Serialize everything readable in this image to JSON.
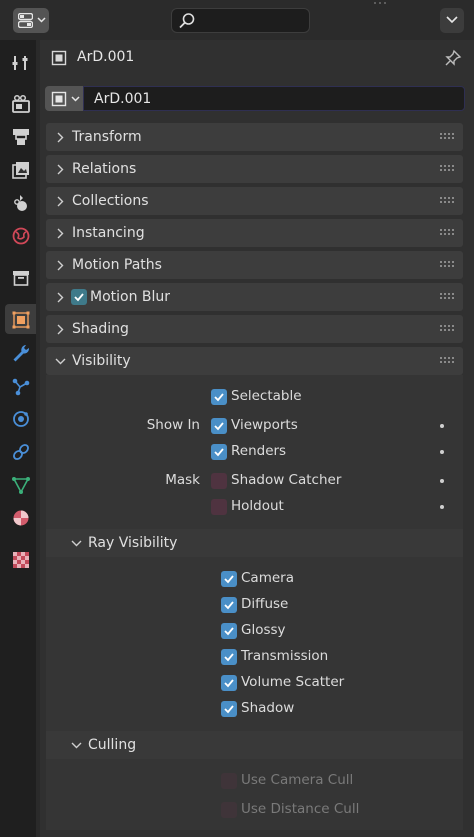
{
  "header": {
    "editor_icon": "properties-editor-icon",
    "search_icon": "search-icon",
    "menu_icon": "chevron-down-icon"
  },
  "tabs": [
    {
      "name": "tool",
      "icon": "tool-icon"
    },
    {
      "name": "render",
      "icon": "render-icon"
    },
    {
      "name": "output",
      "icon": "output-icon"
    },
    {
      "name": "view-layer",
      "icon": "view-layer-icon"
    },
    {
      "name": "scene",
      "icon": "scene-icon"
    },
    {
      "name": "world",
      "icon": "world-icon"
    },
    {
      "name": "collection",
      "icon": "collection-icon"
    },
    {
      "name": "object",
      "icon": "object-icon",
      "active": true
    },
    {
      "name": "modifiers",
      "icon": "wrench-icon"
    },
    {
      "name": "particles",
      "icon": "particles-icon"
    },
    {
      "name": "physics",
      "icon": "physics-icon"
    },
    {
      "name": "constraints",
      "icon": "constraints-icon"
    },
    {
      "name": "data",
      "icon": "mesh-data-icon"
    },
    {
      "name": "material",
      "icon": "material-icon"
    },
    {
      "name": "texture",
      "icon": "texture-icon"
    }
  ],
  "context": {
    "object_name": "ArD.001",
    "name_field_value": "ArD.001"
  },
  "panels": {
    "transform": "Transform",
    "relations": "Relations",
    "collections": "Collections",
    "instancing": "Instancing",
    "motion_paths": "Motion Paths",
    "motion_blur": "Motion Blur",
    "shading": "Shading",
    "visibility": "Visibility"
  },
  "motion_blur_enabled": true,
  "visibility": {
    "selectable": {
      "label": "Selectable",
      "checked": true
    },
    "show_in_label": "Show In",
    "viewports": {
      "label": "Viewports",
      "checked": true
    },
    "renders": {
      "label": "Renders",
      "checked": true
    },
    "mask_label": "Mask",
    "shadow_catcher": {
      "label": "Shadow Catcher",
      "checked": false
    },
    "holdout": {
      "label": "Holdout",
      "checked": false
    }
  },
  "ray_visibility": {
    "title": "Ray Visibility",
    "camera": {
      "label": "Camera",
      "checked": true
    },
    "diffuse": {
      "label": "Diffuse",
      "checked": true
    },
    "glossy": {
      "label": "Glossy",
      "checked": true
    },
    "transmission": {
      "label": "Transmission",
      "checked": true
    },
    "volume_scatter": {
      "label": "Volume Scatter",
      "checked": true
    },
    "shadow": {
      "label": "Shadow",
      "checked": true
    }
  },
  "culling": {
    "title": "Culling",
    "use_camera_cull": {
      "label": "Use Camera Cull",
      "checked": false
    },
    "use_distance_cull": {
      "label": "Use Distance Cull",
      "checked": false
    }
  },
  "colors": {
    "accent": "#4a8fc7",
    "object_active": "#f0a060",
    "unchecked": "#4f3340"
  }
}
